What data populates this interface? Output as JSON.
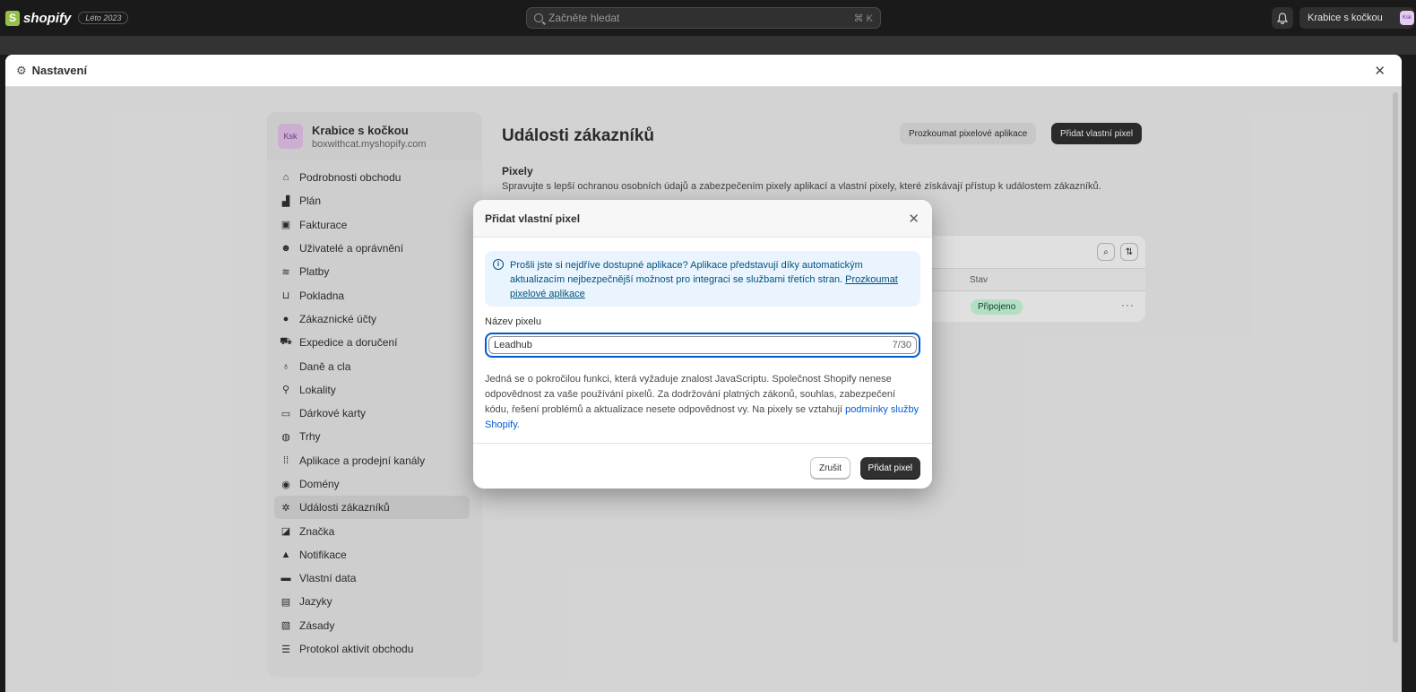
{
  "topbar": {
    "logo_mark": "S",
    "logo_text": "shopify",
    "edition": "Léto 2023",
    "search_placeholder": "Začněte hledat",
    "search_shortcut": "⌘ K",
    "store_button": "Krabice s kočkou",
    "store_initials": "Ksk",
    "icons": [
      "search-icon",
      "bell-icon"
    ]
  },
  "settings": {
    "title": "Nastavení",
    "icons": [
      "gear-icon",
      "close-icon"
    ]
  },
  "sidebar": {
    "store_initials": "Ksk",
    "store_name": "Krabice s kočkou",
    "store_domain": "boxwithcat.myshopify.com",
    "items": [
      {
        "label": "Podrobnosti obchodu",
        "icon": "store-icon"
      },
      {
        "label": "Plán",
        "icon": "plan-icon"
      },
      {
        "label": "Fakturace",
        "icon": "billing-icon"
      },
      {
        "label": "Uživatelé a oprávnění",
        "icon": "users-icon"
      },
      {
        "label": "Platby",
        "icon": "payments-icon"
      },
      {
        "label": "Pokladna",
        "icon": "checkout-icon"
      },
      {
        "label": "Zákaznické účty",
        "icon": "customer-icon"
      },
      {
        "label": "Expedice a doručení",
        "icon": "shipping-icon"
      },
      {
        "label": "Daně a cla",
        "icon": "taxes-icon"
      },
      {
        "label": "Lokality",
        "icon": "location-icon"
      },
      {
        "label": "Dárkové karty",
        "icon": "gift-card-icon"
      },
      {
        "label": "Trhy",
        "icon": "markets-icon"
      },
      {
        "label": "Aplikace a prodejní kanály",
        "icon": "apps-icon"
      },
      {
        "label": "Domény",
        "icon": "domains-icon"
      },
      {
        "label": "Události zákazníků",
        "icon": "events-icon",
        "active": true
      },
      {
        "label": "Značka",
        "icon": "brand-icon"
      },
      {
        "label": "Notifikace",
        "icon": "notification-icon"
      },
      {
        "label": "Vlastní data",
        "icon": "custom-data-icon"
      },
      {
        "label": "Jazyky",
        "icon": "languages-icon"
      },
      {
        "label": "Zásady",
        "icon": "policies-icon"
      },
      {
        "label": "Protokol aktivit obchodu",
        "icon": "activity-log-icon"
      }
    ]
  },
  "main": {
    "title": "Události zákazníků",
    "explore_button": "Prozkoumat pixelové aplikace",
    "add_button": "Přidat vlastní pixel",
    "section_title": "Pixely",
    "section_desc": "Spravujte s lepší ochranou osobních údajů a zabezpečením pixely aplikací a vlastní pixely, které získávají přístup k událostem zákazníků.",
    "table": {
      "column_status": "Stav",
      "row_status": "Připojeno",
      "row_more": "···"
    }
  },
  "modal": {
    "title": "Přidat vlastní pixel",
    "banner_text": "Prošli jste si nejdříve dostupné aplikace? Aplikace představují díky automatickým aktualizacím nejbezpečnější možnost pro integraci se službami třetích stran. ",
    "banner_link": "Prozkoumat pixelové aplikace",
    "field_label": "Název pixelu",
    "field_value": "Leadhub",
    "field_count": "7/30",
    "text": "Jedná se o pokročilou funkci, která vyžaduje znalost JavaScriptu. Společnost Shopify nenese odpovědnost za vaše používání pixelů. Za dodržování platných zákonů, souhlas, zabezpečení kódu, řešení problémů a aktualizace nesete odpovědnost vy. Na pixely se vztahují ",
    "text_link": "podmínky služby Shopify",
    "text_end": ".",
    "cancel_button": "Zrušit",
    "add_button": "Přidat pixel"
  },
  "colors": {
    "topbar": "#1a1a1a",
    "primary_button": "#303030",
    "focus_blue": "#005bd3",
    "banner_bg": "#eaf4ff",
    "status_green_bg": "#cdfee1"
  }
}
